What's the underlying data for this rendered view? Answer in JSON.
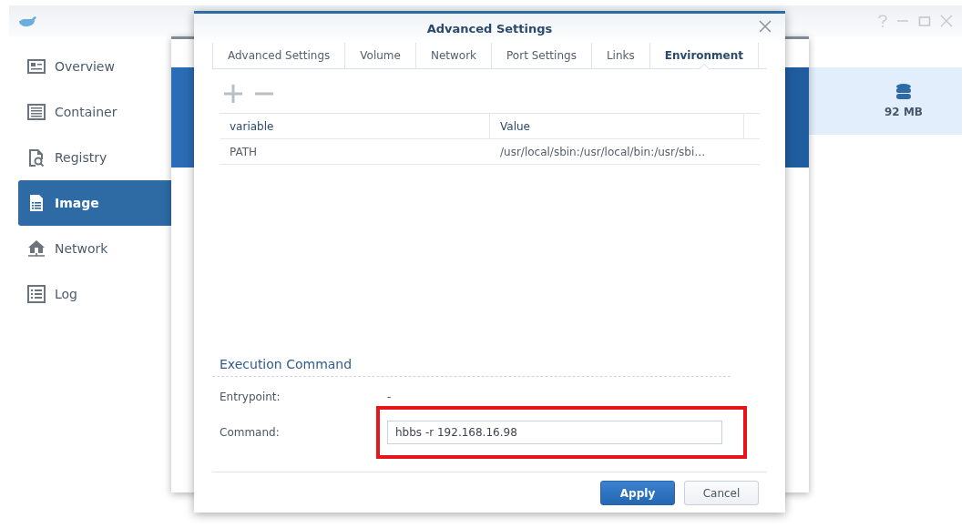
{
  "sidebar": {
    "items": [
      {
        "label": "Overview",
        "selected": false
      },
      {
        "label": "Container",
        "selected": false
      },
      {
        "label": "Registry",
        "selected": false
      },
      {
        "label": "Image",
        "selected": true
      },
      {
        "label": "Network",
        "selected": false
      },
      {
        "label": "Log",
        "selected": false
      }
    ]
  },
  "image_summary": {
    "size": "92 MB"
  },
  "dialog": {
    "title": "Advanced Settings",
    "tabs": [
      {
        "label": "Advanced Settings",
        "selected": false
      },
      {
        "label": "Volume",
        "selected": false
      },
      {
        "label": "Network",
        "selected": false
      },
      {
        "label": "Port Settings",
        "selected": false
      },
      {
        "label": "Links",
        "selected": false
      },
      {
        "label": "Environment",
        "selected": true
      }
    ],
    "table": {
      "columns": [
        "variable",
        "Value"
      ],
      "rows": [
        {
          "variable": "PATH",
          "value": "/usr/local/sbin:/usr/local/bin:/usr/sbi…"
        }
      ]
    },
    "execution": {
      "title": "Execution Command",
      "entrypoint": {
        "label": "Entrypoint:",
        "value": "-"
      },
      "command": {
        "label": "Command:",
        "value": "hbbs -r 192.168.16.98",
        "highlighted": true
      }
    },
    "buttons": [
      {
        "label": "Apply",
        "kind": "primary"
      },
      {
        "label": "Cancel",
        "kind": "secondary"
      }
    ]
  }
}
